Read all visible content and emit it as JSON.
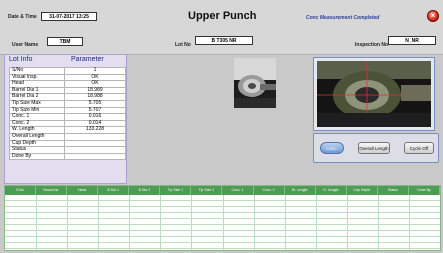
{
  "header": {
    "date_label": "Date & Time",
    "date_value": "31-07-2017 13:25",
    "title": "Upper Punch",
    "status": "Conc Measurement Completed",
    "user_label": "User Name",
    "user_value": "TBM",
    "lot_label": "Lot No",
    "lot_value": "B T305 NR",
    "inspection_label": "Inspection No",
    "inspection_value": "N_NR"
  },
  "lot_panel": {
    "title": "Lot Info",
    "param_header": "Parameter",
    "rows": [
      {
        "label": "S/No",
        "value": "1"
      },
      {
        "label": "Visual Insp.",
        "value": "OK"
      },
      {
        "label": "Head",
        "value": "OK"
      },
      {
        "label": "Barrel Dia 1",
        "value": "18.989"
      },
      {
        "label": "Barrel Dia 2",
        "value": "18.988"
      },
      {
        "label": "Tip Size Max",
        "value": "5.705"
      },
      {
        "label": "Tip Size Min",
        "value": "5.707"
      },
      {
        "label": "Conc. 1",
        "value": "0.016"
      },
      {
        "label": "Conc. 2",
        "value": "0.014"
      },
      {
        "label": "W. Length",
        "value": "133.228"
      },
      {
        "label": "Overall Length",
        "value": ""
      },
      {
        "label": "Cup Depth",
        "value": ""
      },
      {
        "label": "Status",
        "value": ""
      },
      {
        "label": "Done By",
        "value": ""
      }
    ]
  },
  "buttons": {
    "conc": "Conc.",
    "overall_length": "Overall Length",
    "cycle_off": "Cycle Off"
  },
  "grid": {
    "columns": [
      "S.No",
      "Visual Ins.",
      "Head",
      "B Dia 1",
      "B Dia 2",
      "Tip Size 1",
      "Tip Size 2",
      "Conc. 1",
      "Conc. 2",
      "W. Length",
      "O. Length",
      "Cup Depth",
      "Status",
      "Done By"
    ]
  },
  "colors": {
    "grid_header": "#4c9c53",
    "status_text": "#2c3e9a",
    "close_button": "#d92a1a"
  }
}
